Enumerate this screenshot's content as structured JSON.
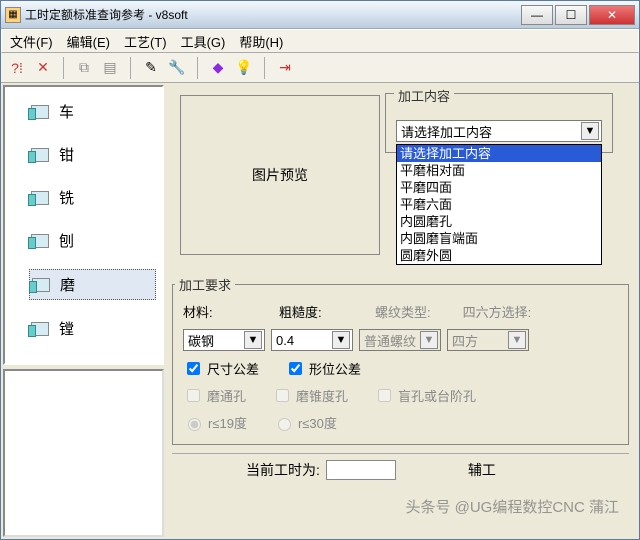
{
  "title": "工时定额标准查询参考 - v8soft",
  "menu": {
    "file": "文件(F)",
    "edit": "编辑(E)",
    "tech": "工艺(T)",
    "tool": "工具(G)",
    "help": "帮助(H)"
  },
  "side": {
    "items": [
      "车",
      "钳",
      "铣",
      "刨",
      "磨",
      "镗"
    ],
    "selected": 4
  },
  "preview_label": "图片预览",
  "content_group": "加工内容",
  "content_placeholder": "请选择加工内容",
  "content_options": [
    "请选择加工内容",
    "平磨相对面",
    "平磨四面",
    "平磨六面",
    "内圆磨孔",
    "内圆磨盲端面",
    "圆磨外圆"
  ],
  "req_group": "加工要求",
  "req": {
    "material_label": "材料:",
    "material_val": "碳钢",
    "rough_label": "粗糙度:",
    "rough_val": "0.4",
    "thread_label": "螺纹类型:",
    "thread_val": "普通螺纹",
    "square_label": "四六方选择:",
    "square_val": "四方",
    "chk_size": "尺寸公差",
    "chk_pos": "形位公差",
    "chk_through": "磨通孔",
    "chk_taper": "磨锥度孔",
    "chk_blind": "盲孔或台阶孔",
    "rad19": "r≤19度",
    "rad30": "r≤30度"
  },
  "footer": {
    "cur_label": "当前工时为:",
    "jt_label": "辅工"
  },
  "watermark": "头条号 @UG编程数控CNC 蒲江"
}
